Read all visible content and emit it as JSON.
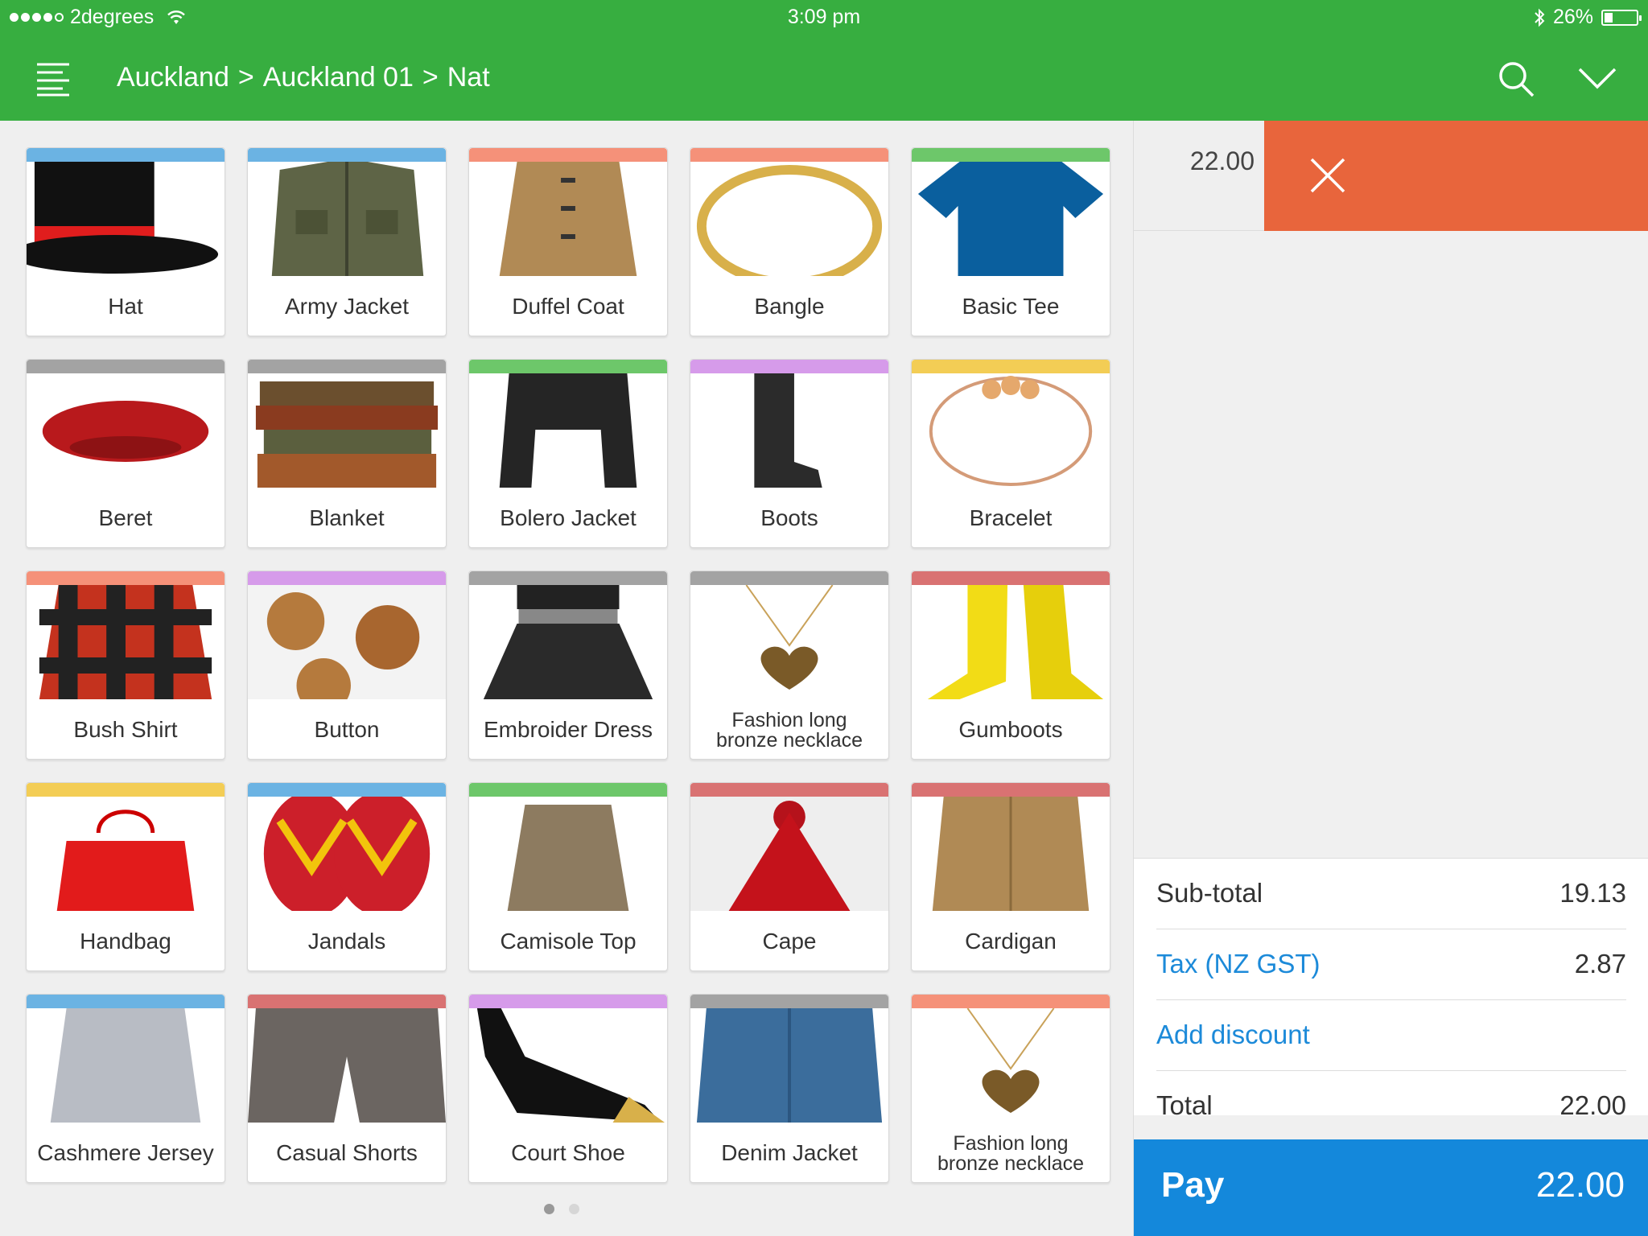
{
  "status_bar": {
    "carrier": "2degrees",
    "time": "3:09 pm",
    "battery": "26%",
    "battery_level": 0.26
  },
  "header": {
    "breadcrumb": [
      "Auckland",
      ">",
      "Auckland 01",
      ">",
      "Nat"
    ]
  },
  "products": [
    {
      "name": "Hat",
      "color": "#6bb3e3",
      "icon": "hat"
    },
    {
      "name": "Army Jacket",
      "color": "#6bb3e3",
      "icon": "army-jacket"
    },
    {
      "name": "Duffel Coat",
      "color": "#f59179",
      "icon": "duffel-coat"
    },
    {
      "name": "Bangle",
      "color": "#f59179",
      "icon": "bangle"
    },
    {
      "name": "Basic Tee",
      "color": "#6dc76a",
      "icon": "basic-tee"
    },
    {
      "name": "Beret",
      "color": "#a3a3a3",
      "icon": "beret"
    },
    {
      "name": "Blanket",
      "color": "#a3a3a3",
      "icon": "blanket"
    },
    {
      "name": "Bolero Jacket",
      "color": "#6dc76a",
      "icon": "bolero-jacket"
    },
    {
      "name": "Boots",
      "color": "#d69bea",
      "icon": "boots"
    },
    {
      "name": "Bracelet",
      "color": "#f3cd55",
      "icon": "bracelet"
    },
    {
      "name": "Bush Shirt",
      "color": "#f59179",
      "icon": "bush-shirt"
    },
    {
      "name": "Button",
      "color": "#d69bea",
      "icon": "button"
    },
    {
      "name": "Embroider Dress",
      "color": "#a3a3a3",
      "icon": "dress"
    },
    {
      "name": "Fashion long bronze necklace",
      "color": "#a3a3a3",
      "icon": "necklace"
    },
    {
      "name": "Gumboots",
      "color": "#d97272",
      "icon": "gumboots"
    },
    {
      "name": "Handbag",
      "color": "#f3cd55",
      "icon": "handbag"
    },
    {
      "name": "Jandals",
      "color": "#6bb3e3",
      "icon": "jandals"
    },
    {
      "name": "Camisole Top",
      "color": "#6dc76a",
      "icon": "camisole"
    },
    {
      "name": "Cape",
      "color": "#d97272",
      "icon": "cape"
    },
    {
      "name": "Cardigan",
      "color": "#d97272",
      "icon": "cardigan"
    },
    {
      "name": "Cashmere Jersey",
      "color": "#6bb3e3",
      "icon": "jersey"
    },
    {
      "name": "Casual Shorts",
      "color": "#d97272",
      "icon": "shorts"
    },
    {
      "name": "Court Shoe",
      "color": "#d69bea",
      "icon": "shoe"
    },
    {
      "name": "Denim Jacket",
      "color": "#a3a3a3",
      "icon": "denim-jacket"
    },
    {
      "name": "Fashion long bronze necklace",
      "color": "#f59179",
      "icon": "necklace"
    }
  ],
  "sale": {
    "line_item_price": "22.00",
    "subtotal_label": "Sub-total",
    "subtotal_value": "19.13",
    "tax_label": "Tax (NZ GST)",
    "tax_value": "2.87",
    "discount_label": "Add discount",
    "total_label": "Total",
    "total_value": "22.00",
    "pay_label": "Pay",
    "pay_amount": "22.00"
  },
  "pager": {
    "pages": 2,
    "current": 1
  },
  "colors": {
    "header": "#37ae40",
    "delete": "#e8653c",
    "pay": "#1488db",
    "link": "#1c8ad9"
  }
}
